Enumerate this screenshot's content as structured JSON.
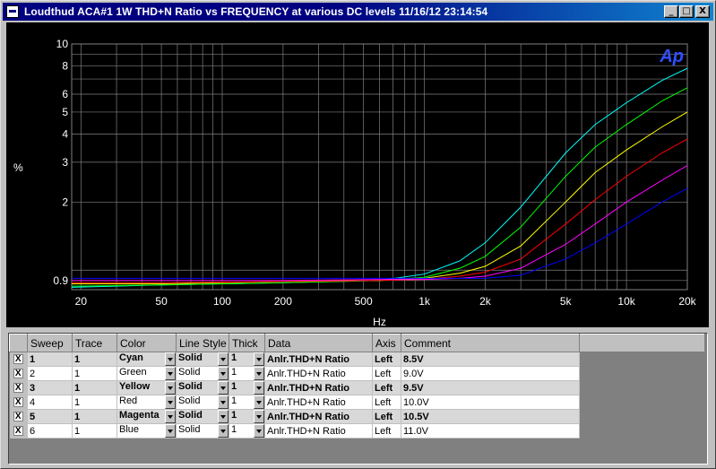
{
  "window": {
    "title": "Loudthud  ACA#1 1W THD+N Ratio vs FREQUENCY at various DC levels  11/16/12 23:14:54",
    "buttons": {
      "minimize": "_",
      "maximize": "□",
      "close": "X"
    }
  },
  "chart_data": {
    "type": "line",
    "title": "",
    "logo": "Ap",
    "xlabel": "Hz",
    "ylabel": "%",
    "xscale": "log",
    "yscale": "log",
    "xlim": [
      18,
      20000
    ],
    "ylim": [
      0.82,
      10
    ],
    "x_ticks": [
      {
        "v": 20,
        "label": "20"
      },
      {
        "v": 50,
        "label": "50"
      },
      {
        "v": 100,
        "label": "100"
      },
      {
        "v": 200,
        "label": "200"
      },
      {
        "v": 500,
        "label": "500"
      },
      {
        "v": 1000,
        "label": "1k"
      },
      {
        "v": 2000,
        "label": "2k"
      },
      {
        "v": 5000,
        "label": "5k"
      },
      {
        "v": 10000,
        "label": "10k"
      },
      {
        "v": 20000,
        "label": "20k"
      }
    ],
    "y_ticks": [
      {
        "v": 0.9,
        "label": "0.9"
      },
      {
        "v": 2,
        "label": "2"
      },
      {
        "v": 3,
        "label": "3"
      },
      {
        "v": 4,
        "label": "4"
      },
      {
        "v": 5,
        "label": "5"
      },
      {
        "v": 6,
        "label": "6"
      },
      {
        "v": 8,
        "label": "8"
      },
      {
        "v": 10,
        "label": "10"
      }
    ],
    "grid": true,
    "background": "#000000",
    "grid_color": "#808080",
    "text_color": "#ffffff",
    "logo_color": "#3050ff",
    "x": [
      18,
      50,
      200,
      600,
      1000,
      1500,
      2000,
      3000,
      5000,
      7000,
      10000,
      15000,
      20000
    ],
    "series": [
      {
        "name": "Cyan",
        "color": "#00ffff",
        "values": [
          0.84,
          0.86,
          0.88,
          0.9,
          0.96,
          1.1,
          1.32,
          1.9,
          3.3,
          4.4,
          5.5,
          6.9,
          7.8
        ]
      },
      {
        "name": "Green",
        "color": "#00ff00",
        "values": [
          0.85,
          0.86,
          0.88,
          0.9,
          0.93,
          1.02,
          1.15,
          1.55,
          2.6,
          3.5,
          4.4,
          5.6,
          6.4
        ]
      },
      {
        "name": "Yellow",
        "color": "#ffff00",
        "values": [
          0.87,
          0.87,
          0.89,
          0.9,
          0.92,
          0.97,
          1.04,
          1.28,
          2.0,
          2.7,
          3.4,
          4.3,
          5.0
        ]
      },
      {
        "name": "Red",
        "color": "#ff0000",
        "values": [
          0.88,
          0.88,
          0.89,
          0.9,
          0.91,
          0.94,
          0.98,
          1.12,
          1.6,
          2.05,
          2.6,
          3.3,
          3.8
        ]
      },
      {
        "name": "Magenta",
        "color": "#ff00ff",
        "values": [
          0.9,
          0.9,
          0.9,
          0.91,
          0.91,
          0.92,
          0.94,
          1.02,
          1.3,
          1.6,
          2.0,
          2.5,
          2.9
        ]
      },
      {
        "name": "Blue",
        "color": "#0000ff",
        "values": [
          0.92,
          0.92,
          0.92,
          0.92,
          0.92,
          0.92,
          0.92,
          0.95,
          1.12,
          1.32,
          1.6,
          2.0,
          2.3
        ]
      }
    ]
  },
  "table": {
    "headers": [
      "",
      "Sweep",
      "Trace",
      "Color",
      "Line Style",
      "Thick",
      "Data",
      "Axis",
      "Comment"
    ],
    "rows": [
      {
        "checked": "X",
        "sweep": "1",
        "trace": "1",
        "color": "Cyan",
        "style": "Solid",
        "thick": "1",
        "data": "Anlr.THD+N Ratio",
        "axis": "Left",
        "comment": "8.5V",
        "bold": true
      },
      {
        "checked": "X",
        "sweep": "2",
        "trace": "1",
        "color": "Green",
        "style": "Solid",
        "thick": "1",
        "data": "Anlr.THD+N Ratio",
        "axis": "Left",
        "comment": "9.0V",
        "bold": false
      },
      {
        "checked": "X",
        "sweep": "3",
        "trace": "1",
        "color": "Yellow",
        "style": "Solid",
        "thick": "1",
        "data": "Anlr.THD+N Ratio",
        "axis": "Left",
        "comment": "9.5V",
        "bold": true
      },
      {
        "checked": "X",
        "sweep": "4",
        "trace": "1",
        "color": "Red",
        "style": "Solid",
        "thick": "1",
        "data": "Anlr.THD+N Ratio",
        "axis": "Left",
        "comment": "10.0V",
        "bold": false
      },
      {
        "checked": "X",
        "sweep": "5",
        "trace": "1",
        "color": "Magenta",
        "style": "Solid",
        "thick": "1",
        "data": "Anlr.THD+N Ratio",
        "axis": "Left",
        "comment": "10.5V",
        "bold": true
      },
      {
        "checked": "X",
        "sweep": "6",
        "trace": "1",
        "color": "Blue",
        "style": "Solid",
        "thick": "1",
        "data": "Anlr.THD+N Ratio",
        "axis": "Left",
        "comment": "11.0V",
        "bold": false
      }
    ]
  }
}
